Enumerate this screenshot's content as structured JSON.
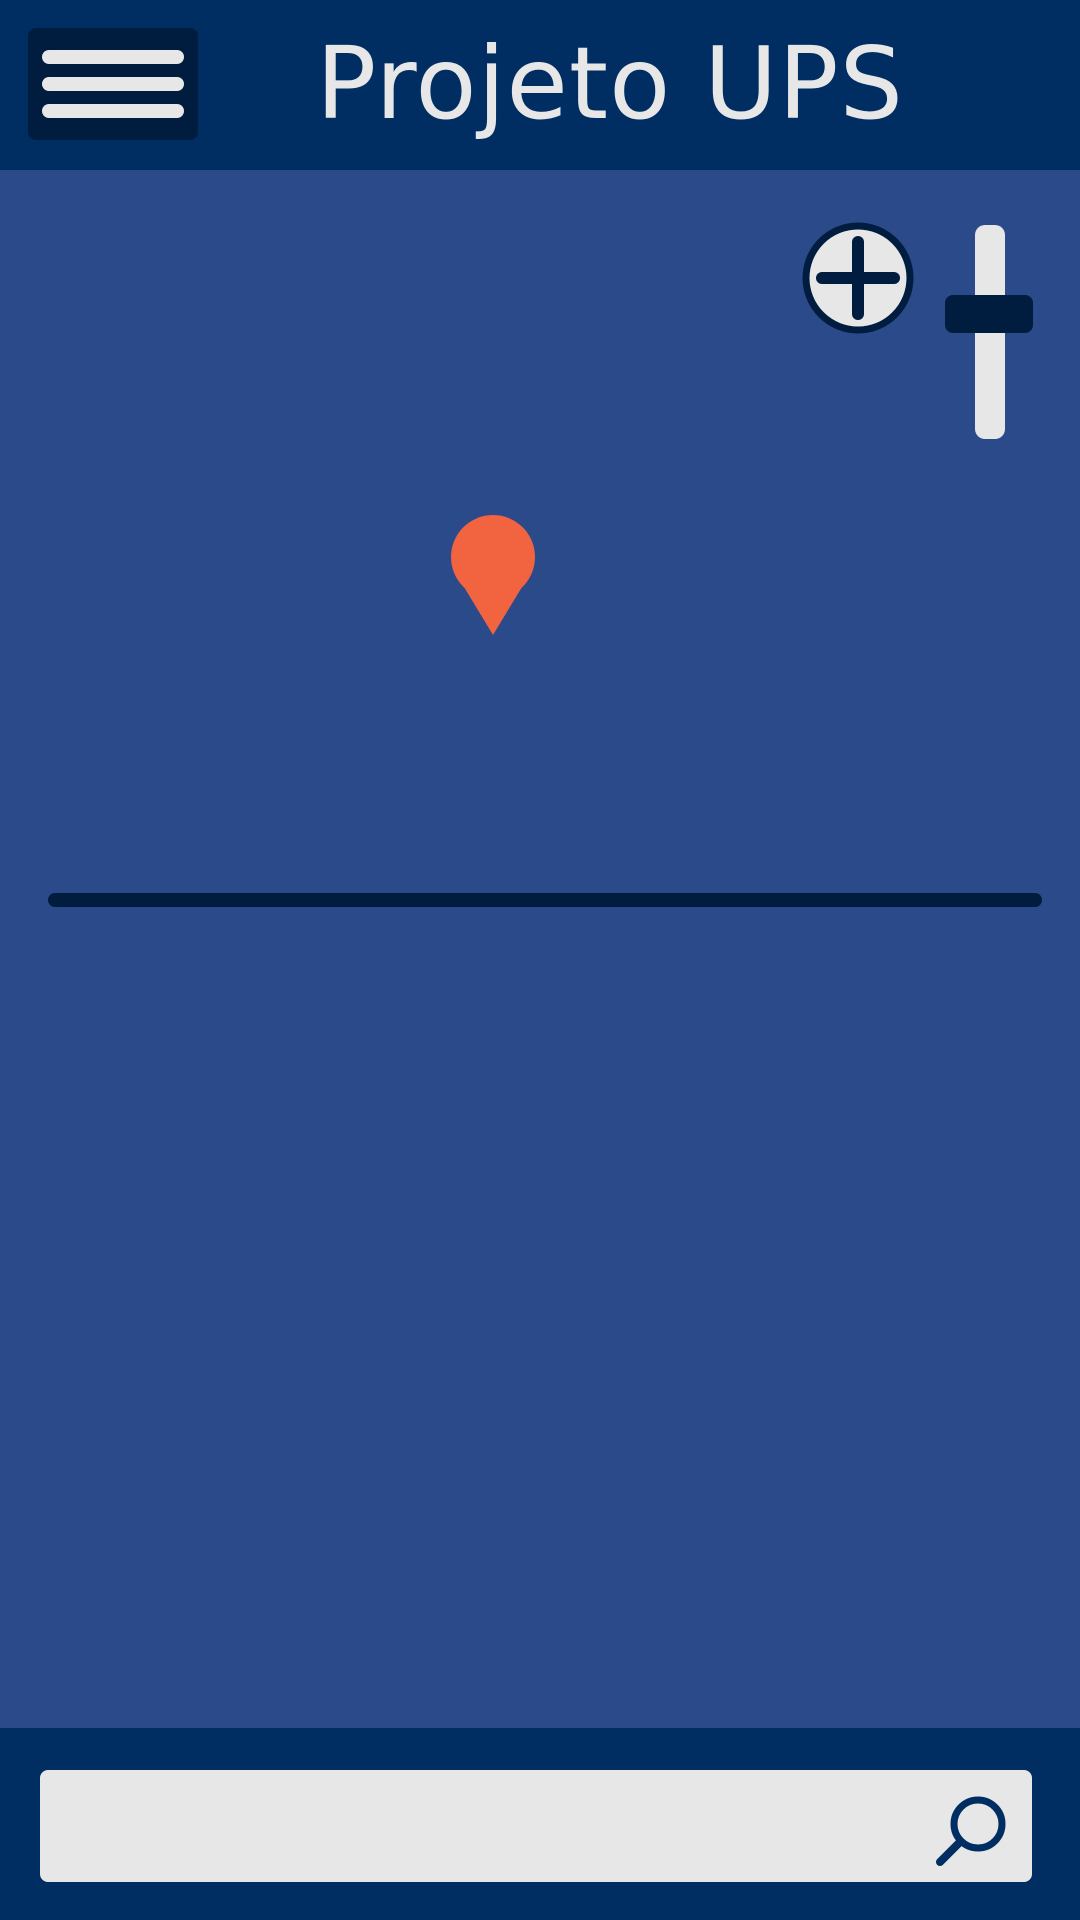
{
  "header": {
    "title": "Projeto UPS",
    "menu_icon": "hamburger-menu-icon"
  },
  "map": {
    "zoom_in_icon": "plus-circle-icon",
    "zoom_level": 0.6,
    "pin_icon": "map-pin-icon"
  },
  "search": {
    "value": "",
    "placeholder": "",
    "icon": "search-icon"
  },
  "colors": {
    "header_background": "#012e62",
    "map_background": "#2b4a8a",
    "dark_accent": "#001c3e",
    "light": "#e7e7e7",
    "pin": "#f26340"
  }
}
